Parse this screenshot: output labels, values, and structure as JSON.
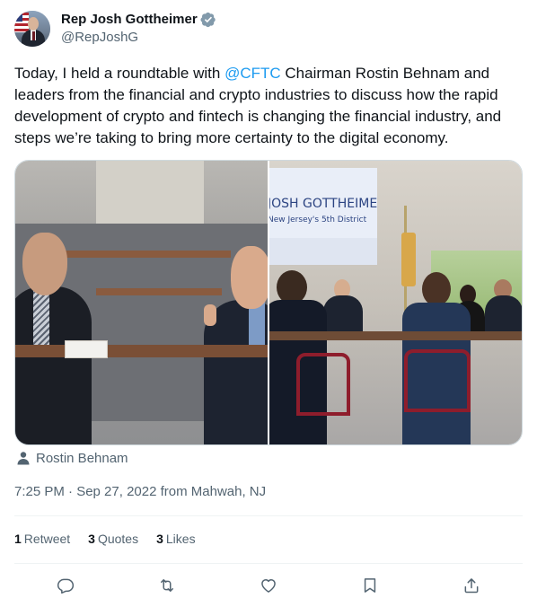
{
  "author": {
    "display_name": "Rep Josh Gottheimer",
    "handle": "@RepJoshG",
    "verified_icon": "verified-badge-icon"
  },
  "tweet": {
    "text_before_mention": "Today, I held a roundtable with ",
    "mention": "@CFTC",
    "text_after_mention": " Chairman Rostin Behnam and leaders from the financial and crypto industries to discuss how the rapid development of crypto and fintech is changing the financial industry, and steps we’re taking to bring more certainty to the digital economy."
  },
  "media": {
    "photo_screen_title": "JOSH GOTTHEIMER",
    "photo_screen_subtitle": "New Jersey's 5th District",
    "tagged_person": "Rostin Behnam"
  },
  "meta": {
    "timestamp": "7:25 PM · Sep 27, 2022 from Mahwah, NJ"
  },
  "stats": {
    "retweets_count": "1",
    "retweets_label": "Retweet",
    "quotes_count": "3",
    "quotes_label": "Quotes",
    "likes_count": "3",
    "likes_label": "Likes"
  },
  "colors": {
    "link": "#1d9bf0",
    "secondary_text": "#536471",
    "primary_text": "#0f1419"
  }
}
